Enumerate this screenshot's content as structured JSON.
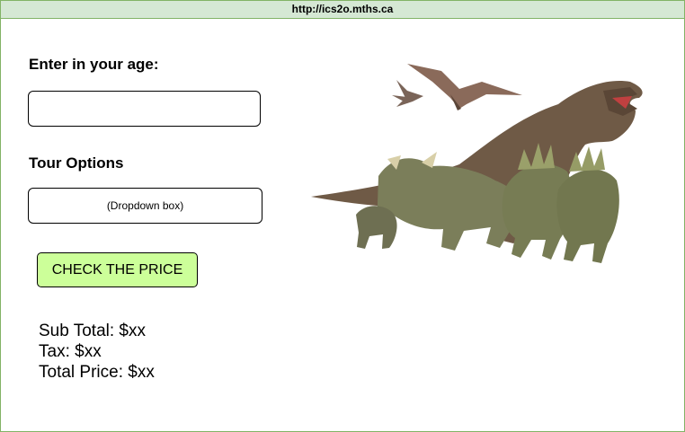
{
  "browser": {
    "url": "http://ics2o.mths.ca"
  },
  "form": {
    "age_label": "Enter in your age:",
    "age_value": "",
    "tour_label": "Tour Options",
    "tour_selected": "(Dropdown box)",
    "check_button": "CHECK THE PRICE"
  },
  "results": {
    "subtotal": "Sub Total: $xx",
    "tax": "Tax: $xx",
    "total": "Total Price: $xx"
  },
  "image": {
    "subject": "dinosaurs-illustration"
  },
  "colors": {
    "frame_border": "#82b366",
    "url_bar": "#d5e8d4",
    "button": "#ccff99"
  }
}
